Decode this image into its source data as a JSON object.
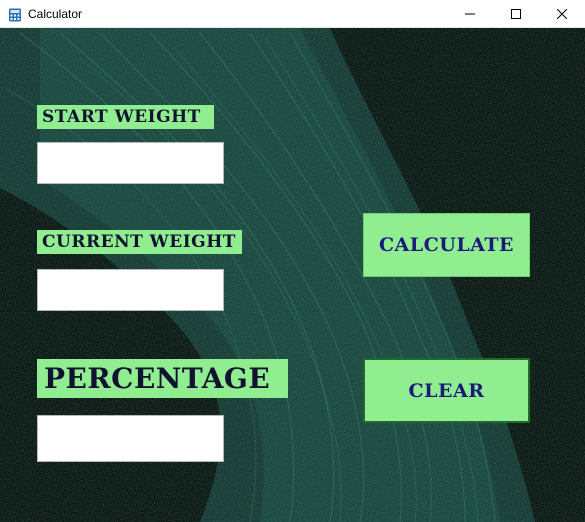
{
  "window": {
    "title": "Calculator",
    "app_icon": "calculator-icon",
    "controls": {
      "minimize_icon": "minimize-icon",
      "maximize_icon": "maximize-icon",
      "close_icon": "close-icon"
    }
  },
  "form": {
    "start_weight_label": "START WEIGHT",
    "start_weight_value": "",
    "current_weight_label": "CURRENT WEIGHT",
    "current_weight_value": "",
    "percentage_label": "PERCENTAGE",
    "percentage_value": ""
  },
  "buttons": {
    "calculate_label": "CALCULATE",
    "clear_label": "CLEAR"
  },
  "colors": {
    "label_bg": "#90ee90",
    "button_text": "#1a1a7a",
    "background": "#0e1713",
    "brush_stroke": "#1f5e52"
  }
}
